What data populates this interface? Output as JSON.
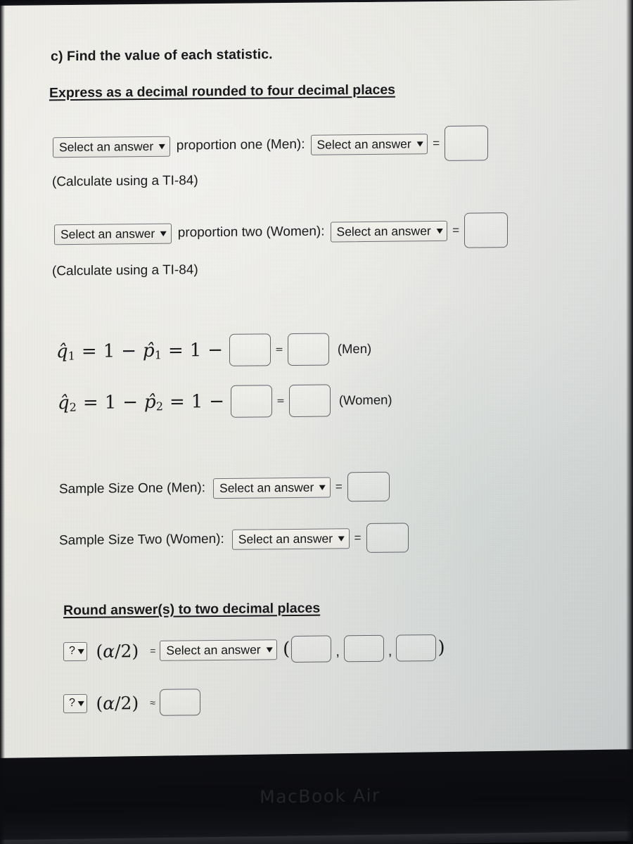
{
  "device": {
    "logo": "MacBook Air"
  },
  "problem": {
    "part_heading": "c) Find the value of each statistic.",
    "decimal_instruction": "Express as a decimal rounded to four decimal places",
    "round_instruction": "Round answer(s) to two decimal places",
    "select_placeholder": "Select an answer",
    "question_placeholder": "?",
    "chevron": "⌄",
    "equals": "=",
    "approx_equals": "≈",
    "comma": ",",
    "open_paren": "(",
    "close_paren": ")"
  },
  "proportion_rows": [
    {
      "id": "proportion-one",
      "prefix_select": "Select an answer",
      "label": "proportion one (Men):",
      "value_select": "Select an answer",
      "equals": "=",
      "note": "(Calculate using a TI-84)"
    },
    {
      "id": "proportion-two",
      "prefix_select": "Select an answer",
      "label": "proportion two (Women):",
      "value_select": "Select an answer",
      "equals": "=",
      "note": "(Calculate using a TI-84)"
    }
  ],
  "math_rows": [
    {
      "id": "q-hat-one",
      "q_symbol": "q̂",
      "q_sub": "1",
      "eq1": "=",
      "one_a": "1",
      "minus_a": "−",
      "p_symbol": "p̂",
      "p_sub": "1",
      "eq2": "=",
      "one_b": "1",
      "minus_b": "−",
      "eq3": "=",
      "group": "(Men)"
    },
    {
      "id": "q-hat-two",
      "q_symbol": "q̂",
      "q_sub": "2",
      "eq1": "=",
      "one_a": "1",
      "minus_a": "−",
      "p_symbol": "p̂",
      "p_sub": "2",
      "eq2": "=",
      "one_b": "1",
      "minus_b": "−",
      "eq3": "=",
      "group": "(Women)"
    }
  ],
  "sample_size_rows": [
    {
      "id": "sample-size-one",
      "label": "Sample Size One (Men):",
      "select": "Select an answer",
      "equals": "="
    },
    {
      "id": "sample-size-two",
      "label": "Sample Size Two (Women):",
      "select": "Select an answer",
      "equals": "="
    }
  ],
  "alpha_rows": [
    {
      "id": "alpha-row-one",
      "question_select": "?",
      "expr_open": "(",
      "alpha": "α",
      "slash": "/",
      "two": "2",
      "expr_close": ")",
      "equals": "=",
      "select": "Select an answer",
      "tuple_open": "(",
      "tuple_close": ")",
      "comma": ","
    },
    {
      "id": "alpha-row-two",
      "question_select": "?",
      "expr_open": "(",
      "alpha": "α",
      "slash": "/",
      "two": "2",
      "expr_close": ")",
      "equals": "≈"
    }
  ],
  "colors": {
    "screen_light": "#ecebe4",
    "screen_shadow": "#c6cbcb",
    "text": "#191a1c",
    "control_border": "#6d6f72",
    "input_border": "#62656a",
    "bezel": "#0a0b0e"
  }
}
